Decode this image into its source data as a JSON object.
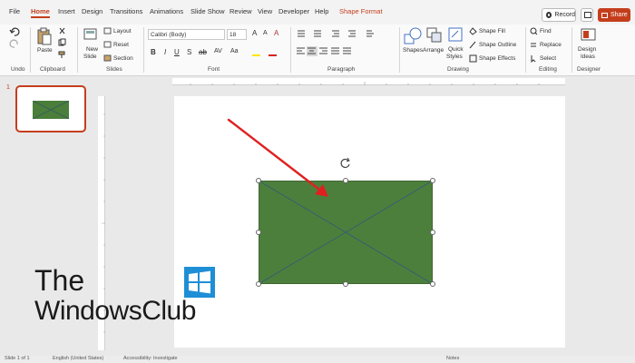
{
  "tabs": [
    "File",
    "Home",
    "Insert",
    "Design",
    "Transitions",
    "Animations",
    "Slide Show",
    "Review",
    "View",
    "Developer",
    "Help",
    "Shape Format"
  ],
  "record_label": "Record",
  "share_label": "Share",
  "ribbon": {
    "undo_group": "Undo",
    "clipboard": {
      "paste": "Paste",
      "group": "Clipboard"
    },
    "slides": {
      "new_slide": "New",
      "new_slide2": "Slide",
      "layout": "Layout",
      "reset": "Reset",
      "section": "Section",
      "group": "Slides"
    },
    "font": {
      "name": "Calibri (Body)",
      "size": "18",
      "group": "Font"
    },
    "paragraph": {
      "group": "Paragraph"
    },
    "drawing": {
      "shapes": "Shapes",
      "arrange": "Arrange",
      "quick_styles": "Quick",
      "quick_styles2": "Styles",
      "shape_fill": "Shape Fill",
      "shape_outline": "Shape Outline",
      "shape_effects": "Shape Effects",
      "group": "Drawing"
    },
    "editing": {
      "find": "Find",
      "replace": "Replace",
      "select": "Select",
      "group": "Editing"
    },
    "designer": {
      "design_ideas": "Design",
      "design_ideas2": "Ideas",
      "group": "Designer"
    }
  },
  "thumbnail_number": "1",
  "watermark": {
    "line1": "The",
    "line2": "WindowsClub"
  },
  "status": {
    "slide_info": "Slide 1 of 1",
    "language": "English (United States)",
    "accessibility": "Accessibility: Investigate",
    "notes": "Notes"
  },
  "colors": {
    "accent": "#c43e1c",
    "shape_fill": "#4d7f3c",
    "arrow": "#e02020"
  }
}
